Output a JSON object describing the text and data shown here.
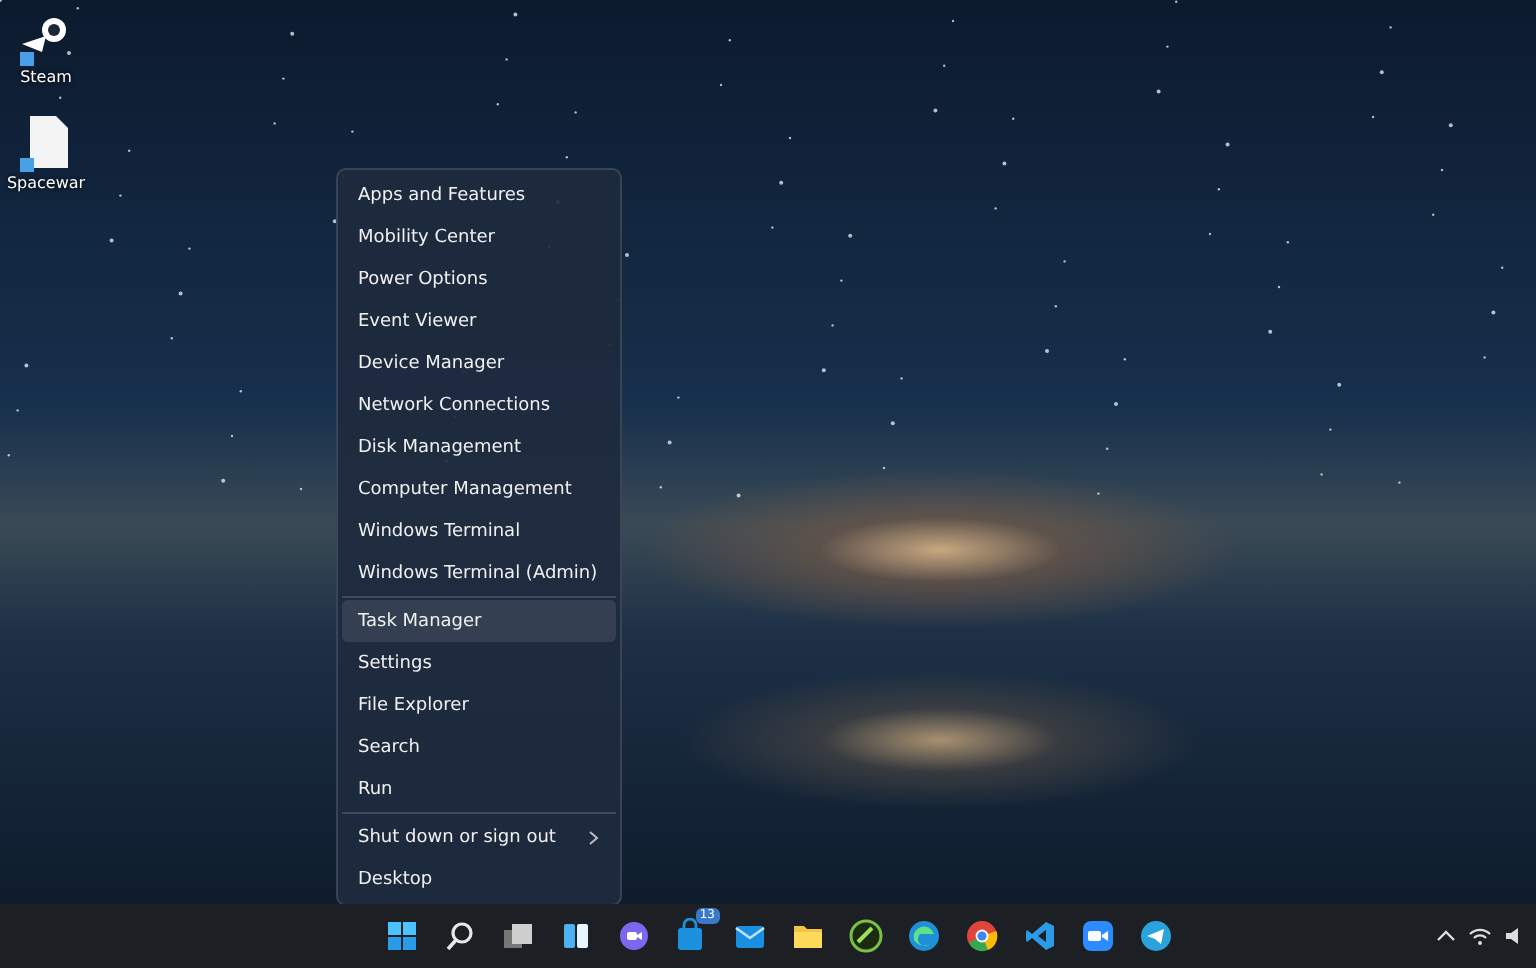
{
  "desktop_icons": [
    {
      "label": "Steam",
      "kind": "steam"
    },
    {
      "label": "Spacewar",
      "kind": "file"
    }
  ],
  "context_menu": {
    "groups": [
      {
        "items": [
          {
            "label": "Apps and Features",
            "selected": false,
            "submenu": false
          },
          {
            "label": "Mobility Center",
            "selected": false,
            "submenu": false
          },
          {
            "label": "Power Options",
            "selected": false,
            "submenu": false
          },
          {
            "label": "Event Viewer",
            "selected": false,
            "submenu": false
          },
          {
            "label": "Device Manager",
            "selected": false,
            "submenu": false
          },
          {
            "label": "Network Connections",
            "selected": false,
            "submenu": false
          },
          {
            "label": "Disk Management",
            "selected": false,
            "submenu": false
          },
          {
            "label": "Computer Management",
            "selected": false,
            "submenu": false
          },
          {
            "label": "Windows Terminal",
            "selected": false,
            "submenu": false
          },
          {
            "label": "Windows Terminal (Admin)",
            "selected": false,
            "submenu": false
          }
        ]
      },
      {
        "items": [
          {
            "label": "Task Manager",
            "selected": true,
            "submenu": false
          },
          {
            "label": "Settings",
            "selected": false,
            "submenu": false
          },
          {
            "label": "File Explorer",
            "selected": false,
            "submenu": false
          },
          {
            "label": "Search",
            "selected": false,
            "submenu": false
          },
          {
            "label": "Run",
            "selected": false,
            "submenu": false
          }
        ]
      },
      {
        "items": [
          {
            "label": "Shut down or sign out",
            "selected": false,
            "submenu": true
          },
          {
            "label": "Desktop",
            "selected": false,
            "submenu": false
          }
        ]
      }
    ]
  },
  "taskbar": {
    "apps": [
      {
        "kind": "start"
      },
      {
        "kind": "search"
      },
      {
        "kind": "taskview"
      },
      {
        "kind": "widgets"
      },
      {
        "kind": "chat"
      },
      {
        "kind": "store",
        "badge": "13"
      },
      {
        "kind": "mail"
      },
      {
        "kind": "folder"
      },
      {
        "kind": "green"
      },
      {
        "kind": "edge"
      },
      {
        "kind": "chrome"
      },
      {
        "kind": "vscode"
      },
      {
        "kind": "zoom"
      },
      {
        "kind": "telegram"
      }
    ]
  }
}
